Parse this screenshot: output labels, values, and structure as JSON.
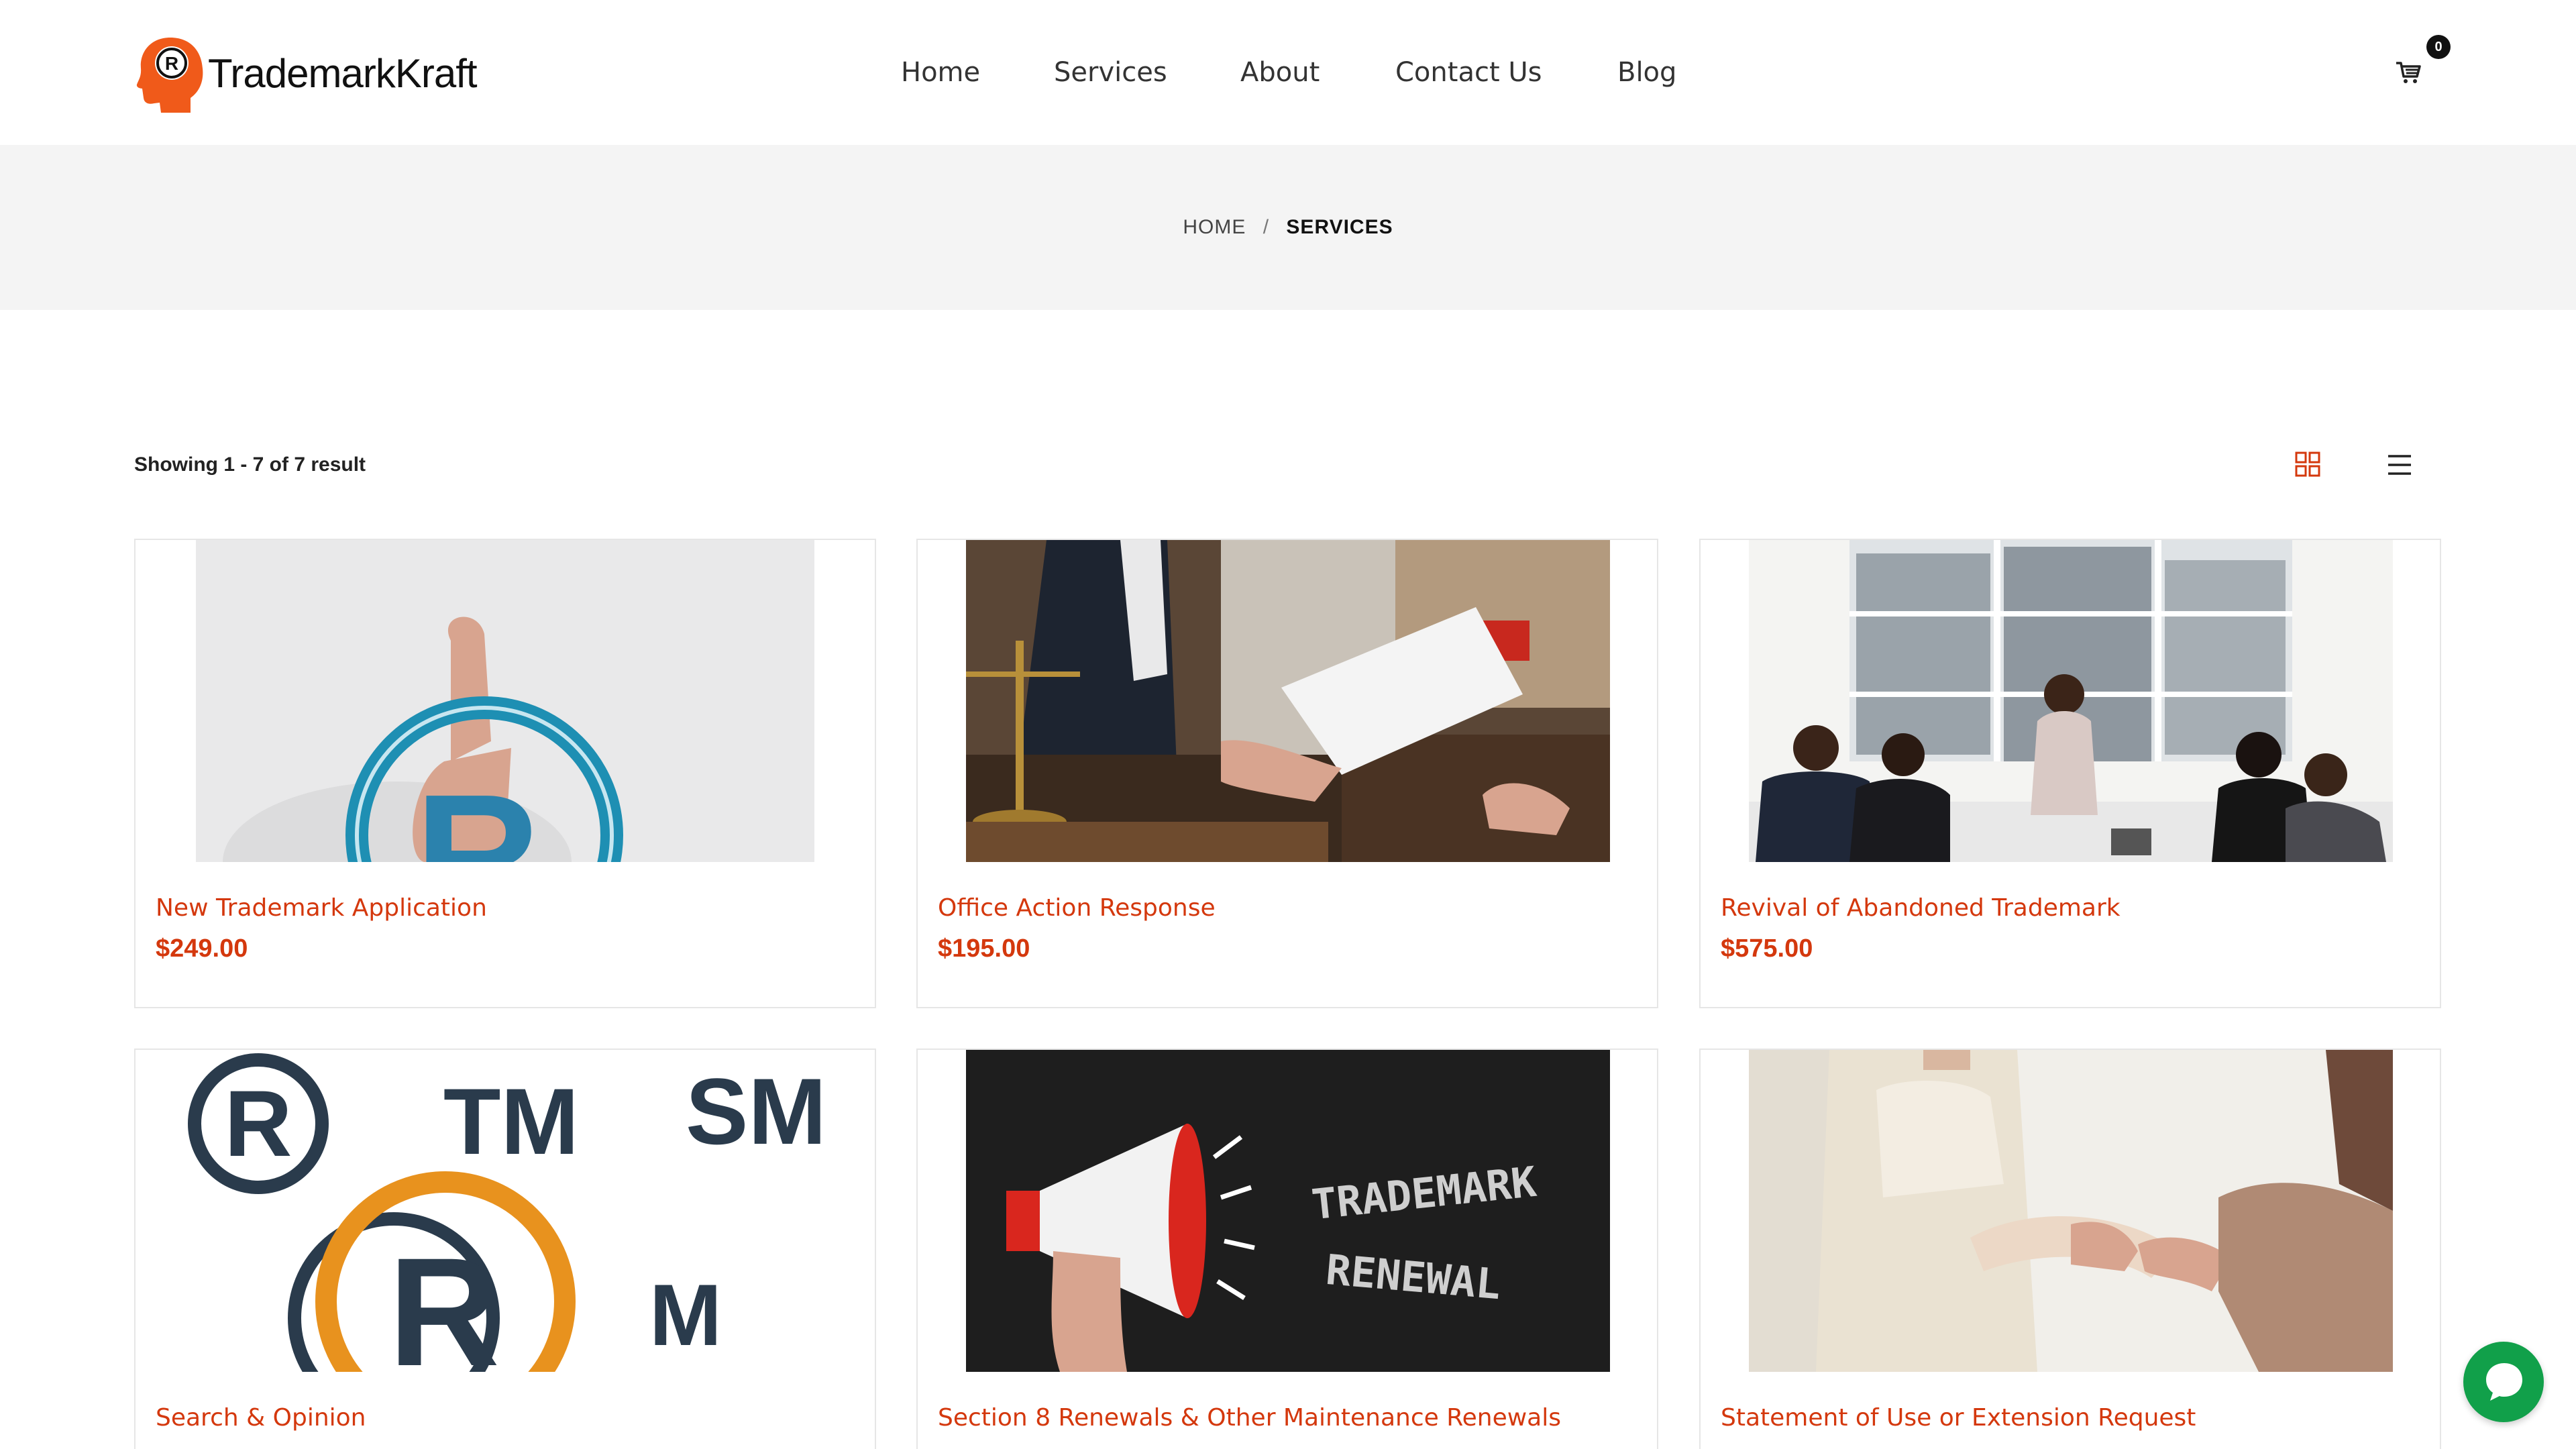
{
  "brand": {
    "name": "TrademarkKraft",
    "accent": "#d4380d"
  },
  "nav": {
    "items": [
      "Home",
      "Services",
      "About",
      "Contact Us",
      "Blog"
    ]
  },
  "cart": {
    "count": "0",
    "icon": "cart-icon"
  },
  "breadcrumb": {
    "home": "HOME",
    "separator": "/",
    "current": "SERVICES"
  },
  "toolbar": {
    "result_count": "Showing 1 - 7 of 7 result",
    "grid_icon": "grid-view-icon",
    "list_icon": "list-view-icon"
  },
  "products": [
    {
      "title": "New Trademark Application",
      "price": "$249.00"
    },
    {
      "title": "Office Action Response",
      "price": "$195.00"
    },
    {
      "title": "Revival of Abandoned Trademark",
      "price": "$575.00"
    },
    {
      "title": "Search & Opinion",
      "price": ""
    },
    {
      "title": "Section 8 Renewals & Other Maintenance Renewals",
      "price": ""
    },
    {
      "title": "Statement of Use or Extension Request",
      "price": ""
    }
  ],
  "images": {
    "trademark_renewal_text_1": "TRADEMARK",
    "trademark_renewal_text_2": "RENEWAL",
    "symbol_r": "R",
    "symbol_tm": "TM",
    "symbol_sm": "SM",
    "symbol_m": "M"
  },
  "chat": {
    "icon": "chat-bubble-icon",
    "color": "#11a04a"
  }
}
